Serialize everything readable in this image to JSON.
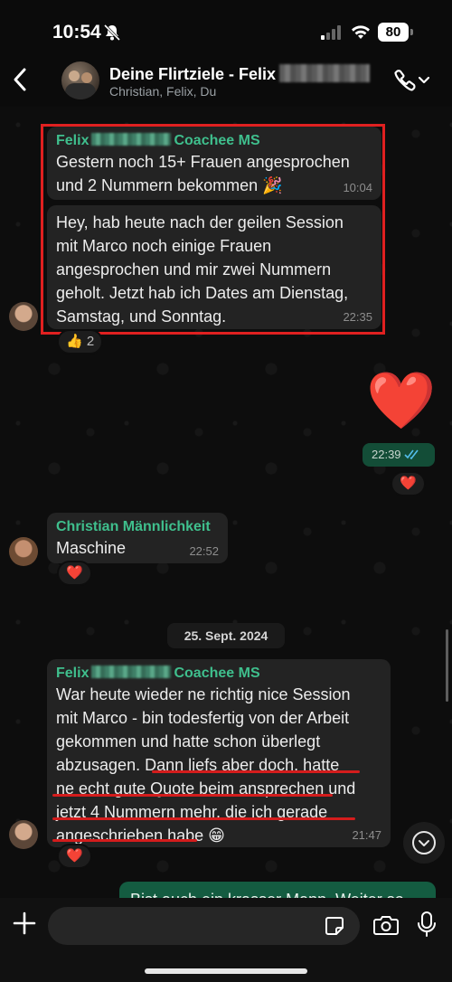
{
  "status_bar": {
    "time": "10:54",
    "battery": "80"
  },
  "header": {
    "title": "Deine Flirtziele - Felix",
    "subtitle": "Christian, Felix, Du"
  },
  "messages": {
    "m1": {
      "sender_first": "Felix",
      "sender_suffix": "Coachee MS",
      "text": "Gestern noch 15+ Frauen angesprochen und 2 Nummern bekommen 🎉",
      "time": "10:04"
    },
    "m2": {
      "text": "Hey, hab heute nach der geilen Session mit Marco noch einige Frauen angesprochen und mir zwei Nummern geholt. Jetzt hab ich Dates am Dienstag, Samstag, und Sonntag.",
      "time": "22:35",
      "reaction": "👍",
      "reaction_count": "2"
    },
    "m3": {
      "emoji": "❤️",
      "time": "22:39",
      "reaction": "❤️"
    },
    "m4": {
      "sender": "Christian Männlichkeit",
      "text": "Maschine",
      "time": "22:52",
      "reaction": "❤️"
    },
    "date_separator": "25. Sept. 2024",
    "m5": {
      "sender_first": "Felix",
      "sender_suffix": "Coachee MS",
      "text_lines": [
        "War heute wieder ne richtig nice Session",
        "mit Marco - bin todesfertig von der Arbeit",
        "gekommen und hatte schon überlegt",
        "abzusagen. Dann liefs aber doch, hatte",
        "ne echt gute Quote beim ansprechen und",
        "jetzt 4 Nummern mehr, die ich gerade",
        "angeschrieben habe 😁"
      ],
      "time": "21:47",
      "reaction": "❤️"
    },
    "m6": {
      "text": "Bist auch ein krasser Mann. Weiter so"
    }
  },
  "icons": [
    "back-icon",
    "phone-icon",
    "chevron-down-icon",
    "bell-slash-icon",
    "signal-icon",
    "wifi-icon",
    "plus-icon",
    "sticker-icon",
    "camera-icon",
    "microphone-icon",
    "scroll-down-icon",
    "double-check-icon"
  ],
  "colors": {
    "sender_green": "#3fbf8d",
    "out_bubble": "#145c41",
    "highlight_red": "#e02020"
  }
}
